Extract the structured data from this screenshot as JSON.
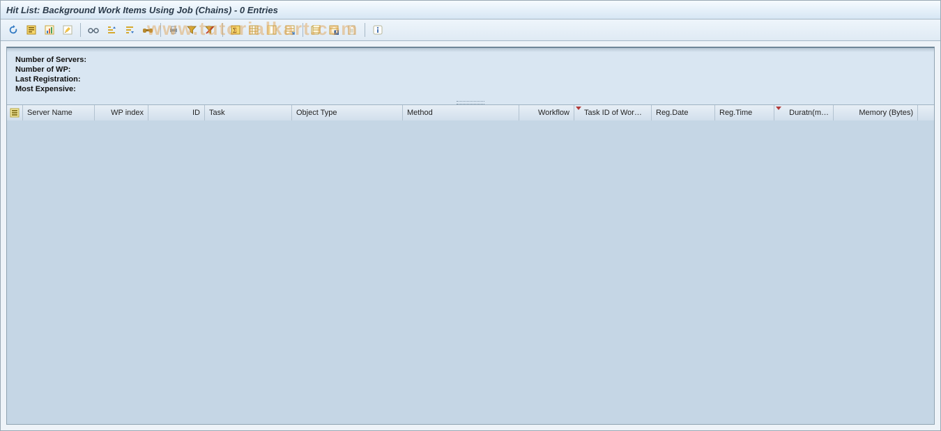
{
  "title": "Hit List: Background Work Items Using Job (Chains)  - 0 Entries",
  "watermark": "www.tutorialkart.com",
  "toolbar": {
    "refresh": "Refresh",
    "report": "Select Layout",
    "graphic": "Graphic",
    "change": "Change Layout",
    "details": "Details",
    "sort_asc": "Sort Ascending",
    "sort_desc": "Sort Descending",
    "find": "Find",
    "print": "Print",
    "filter": "Set Filter",
    "filter_del": "Delete Filter",
    "sum": "Total",
    "subtotal": "Subtotals",
    "columns": "Freeze Columns",
    "export": "Export",
    "layout_chg": "Choose Layout",
    "layout_sav": "Save Layout",
    "doc": "Display Document",
    "info": "Information"
  },
  "summary": {
    "servers_lbl": "Number of Servers:",
    "wp_lbl": "Number of WP:",
    "lastreg_lbl": "Last Registration:",
    "expensive_lbl": "Most Expensive:"
  },
  "columns": {
    "c0": "Server Name",
    "c1": "WP index",
    "c2": "ID",
    "c3": "Task",
    "c4": "Object Type",
    "c5": "Method",
    "c6": "Workflow",
    "c7": "Task ID of Wor…",
    "c8": "Reg.Date",
    "c9": "Reg.Time",
    "c10": "Duratn(m…",
    "c11": "Memory (Bytes)"
  }
}
